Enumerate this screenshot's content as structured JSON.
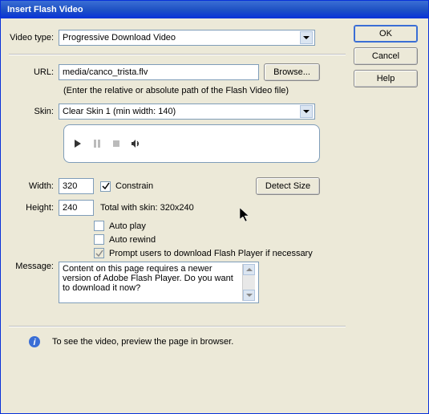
{
  "title": "Insert Flash Video",
  "buttons": {
    "ok": "OK",
    "cancel": "Cancel",
    "help": "Help",
    "browse": "Browse...",
    "detect": "Detect Size"
  },
  "videoType": {
    "label": "Video type:",
    "value": "Progressive Download Video"
  },
  "url": {
    "label": "URL:",
    "value": "media/canco_trista.flv",
    "hint": "(Enter the relative or absolute path of the Flash Video file)"
  },
  "skin": {
    "label": "Skin:",
    "value": "Clear Skin 1 (min width: 140)"
  },
  "width": {
    "label": "Width:",
    "value": "320"
  },
  "height": {
    "label": "Height:",
    "value": "240"
  },
  "constrain": {
    "label": "Constrain",
    "checked": true
  },
  "total": "Total with skin: 320x240",
  "autoplay": {
    "label": "Auto play",
    "checked": false
  },
  "autorewind": {
    "label": "Auto rewind",
    "checked": false
  },
  "prompt": {
    "label": "Prompt users to download Flash Player if necessary",
    "checked": true
  },
  "message": {
    "label": "Message:",
    "value": "Content on this page requires a newer version of Adobe Flash Player. Do you want to download it now?"
  },
  "info": "To see the video, preview the page in browser."
}
